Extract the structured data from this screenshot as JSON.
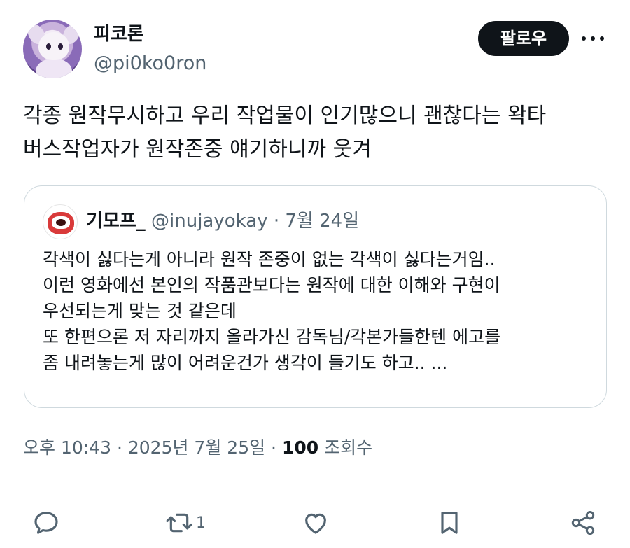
{
  "author": {
    "display_name": "피코론",
    "handle": "@pi0ko0ron"
  },
  "follow_label": "팔로우",
  "tweet_lines": [
    "각종 원작무시하고 우리 작업물이 인기많으니 괜찮다는 왁타",
    "버스작업자가 원작존중 얘기하니까 웃겨"
  ],
  "quote": {
    "display_name": "기모프_",
    "handle": "@inujayokay",
    "separator": "·",
    "date": "7월 24일",
    "lines": [
      "각색이 싫다는게 아니라 원작 존중이 없는 각색이 싫다는거임..",
      "이런 영화에선 본인의 작품관보다는 원작에 대한 이해와 구현이",
      "우선되는게 맞는 것 같은데",
      "또 한편으론 저 자리까지 올라가신 감독님/각본가들한텐 에고를",
      "좀 내려놓는게 많이 어려운건가 생각이 들기도 하고.. ..."
    ]
  },
  "meta": {
    "time": "오후 10:43",
    "sep1": "·",
    "date": "2025년 7월 25일",
    "sep2": "·",
    "views_count": "100",
    "views_label": "조회수"
  },
  "actions": {
    "retweet_count": "1",
    "icons": [
      "reply-icon",
      "retweet-icon",
      "like-icon",
      "bookmark-icon",
      "share-icon"
    ]
  }
}
